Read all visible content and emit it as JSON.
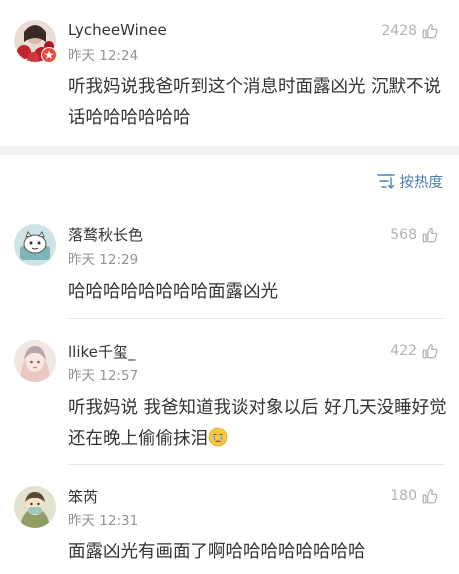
{
  "sort": {
    "label": "按热度",
    "icon": "sort-icon",
    "color": "#4c7fb8"
  },
  "comments": [
    {
      "username": "LycheeWinee",
      "time": "昨天 12:24",
      "likes": "2428",
      "text": "听我妈说我爸听到这个消息时面露凶光 沉默不说话哈哈哈哈哈哈",
      "avatar_icon": "avatar-red-flowers",
      "badge_icon": "verified-star-badge-icon"
    },
    {
      "username": "落鹜秋长色",
      "time": "昨天 12:29",
      "likes": "568",
      "text": "哈哈哈哈哈哈哈哈面露凶光",
      "avatar_icon": "avatar-cartoon-pet"
    },
    {
      "username": "llike千玺_",
      "time": "昨天 12:57",
      "likes": "422",
      "text": "听我妈说 我爸知道我谈对象以后 好几天没睡好觉 还在晚上偷偷抹泪",
      "text_emoji": "crying-face-emoji",
      "avatar_icon": "avatar-illustrated-girl"
    },
    {
      "username": "笨芮",
      "time": "昨天 12:31",
      "likes": "180",
      "text": "面露凶光有画面了啊哈哈哈哈哈哈哈哈",
      "avatar_icon": "avatar-masked-cartoon"
    }
  ],
  "like_icon": "thumbs-up-icon"
}
